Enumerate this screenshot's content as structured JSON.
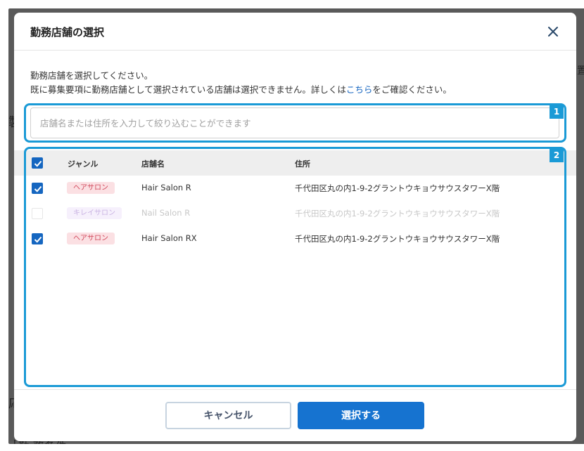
{
  "background": {
    "fragment_a": "製",
    "fragment_b": "応",
    "fragment_c": "│勤 務条件",
    "fragment_d": "置"
  },
  "modal": {
    "title": "勤務店舗の選択",
    "close_icon": "close-icon",
    "intro_line1": "勤務店舗を選択してください。",
    "intro_line2_pre": "既に募集要項に勤務店舗として選択されている店舗は選択できません。詳しくは",
    "intro_link": "こちら",
    "intro_line2_post": "をご確認ください。"
  },
  "search": {
    "placeholder": "店舗名または住所を入力して絞り込むことができます",
    "value": ""
  },
  "annotations": {
    "badge1": "1",
    "badge2": "2"
  },
  "table": {
    "headers": {
      "genre": "ジャンル",
      "name": "店舗名",
      "address": "住所"
    },
    "select_all_checked": true,
    "rows": [
      {
        "checked": true,
        "disabled": false,
        "genre": "ヘアサロン",
        "name": "Hair Salon R",
        "address": "千代田区丸の内1-9-2グラントウキョウサウスタワーX階"
      },
      {
        "checked": false,
        "disabled": true,
        "genre": "キレイサロン",
        "name": "Nail Salon R",
        "address": "千代田区丸の内1-9-2グラントウキョウサウスタワーX階"
      },
      {
        "checked": true,
        "disabled": false,
        "genre": "ヘアサロン",
        "name": "Hair Salon RX",
        "address": "千代田区丸の内1-9-2グラントウキョウサウスタワーX階"
      }
    ]
  },
  "footer": {
    "cancel_label": "キャンセル",
    "submit_label": "選択する"
  },
  "colors": {
    "primary": "#1673d0",
    "highlight": "#1a9ad6",
    "hair_tag_bg": "#fbe0e3",
    "hair_tag_text": "#d0475a"
  }
}
